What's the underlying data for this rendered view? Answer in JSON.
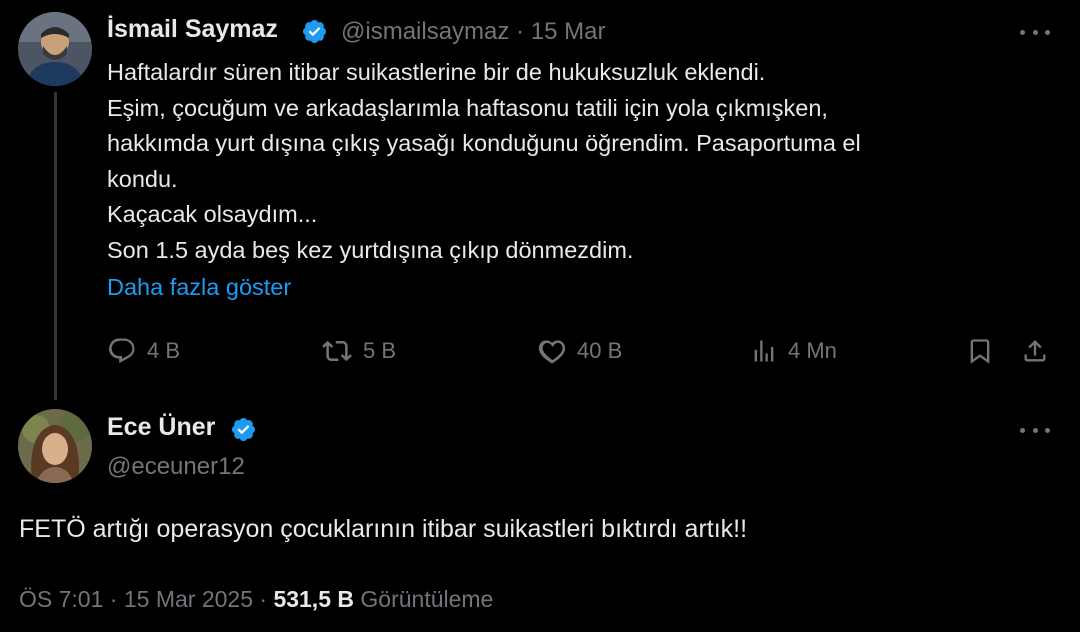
{
  "original_tweet": {
    "author_name": "İsmail Saymaz",
    "handle": "@ismailsaymaz",
    "separator": "·",
    "date": "15 Mar",
    "lines": [
      "Haftalardır süren itibar suikastlerine bir de hukuksuzluk eklendi.",
      "Eşim, çocuğum ve arkadaşlarımla haftasonu tatili için yola çıkmışken,",
      "hakkımda yurt dışına çıkış yasağı konduğunu öğrendim. Pasaportuma el",
      "kondu.",
      "Kaçacak olsaydım...",
      "Son 1.5 ayda beş kez yurtdışına çıkıp dönmezdim."
    ],
    "show_more": "Daha fazla göster",
    "actions": {
      "reply_count": "4 B",
      "repost_count": "5 B",
      "like_count": "40 B",
      "views_count": "4 Mn"
    }
  },
  "reply_tweet": {
    "author_name": "Ece Üner",
    "handle": "@eceuner12",
    "text": "FETÖ artığı operasyon çocuklarının itibar suikastleri bıktırdı artık!!",
    "time": "ÖS 7:01",
    "separator1": "·",
    "date": "15 Mar 2025",
    "separator2": "·",
    "views": "531,5 B",
    "views_label": "Görüntüleme"
  },
  "colors": {
    "background": "#000000",
    "text": "#e7e9ea",
    "muted": "#71767b",
    "accent": "#1d9bf0"
  },
  "icons": [
    "verified-badge-icon",
    "more-icon",
    "reply-icon",
    "repost-icon",
    "like-icon",
    "views-icon",
    "bookmark-icon",
    "share-icon"
  ]
}
